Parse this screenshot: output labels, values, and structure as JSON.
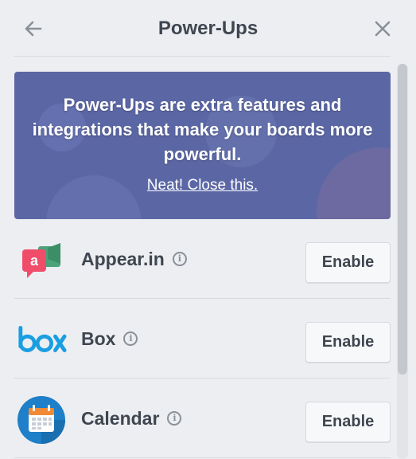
{
  "header": {
    "title": "Power-Ups",
    "back_icon": "arrow-left-icon",
    "close_icon": "close-icon"
  },
  "banner": {
    "text": "Power-Ups are extra features and integrations that make your boards more powerful.",
    "link_label": "Neat! Close this.",
    "bg_color": "#5b67a5"
  },
  "powerups": [
    {
      "name": "Appear.in",
      "icon": "appear-in-logo-icon",
      "action": "Enable",
      "accent": "#f04d6a"
    },
    {
      "name": "Box",
      "icon": "box-logo-icon",
      "action": "Enable",
      "accent": "#1a9ee2"
    },
    {
      "name": "Calendar",
      "icon": "calendar-logo-icon",
      "action": "Enable",
      "accent": "#1f7fc8"
    }
  ]
}
